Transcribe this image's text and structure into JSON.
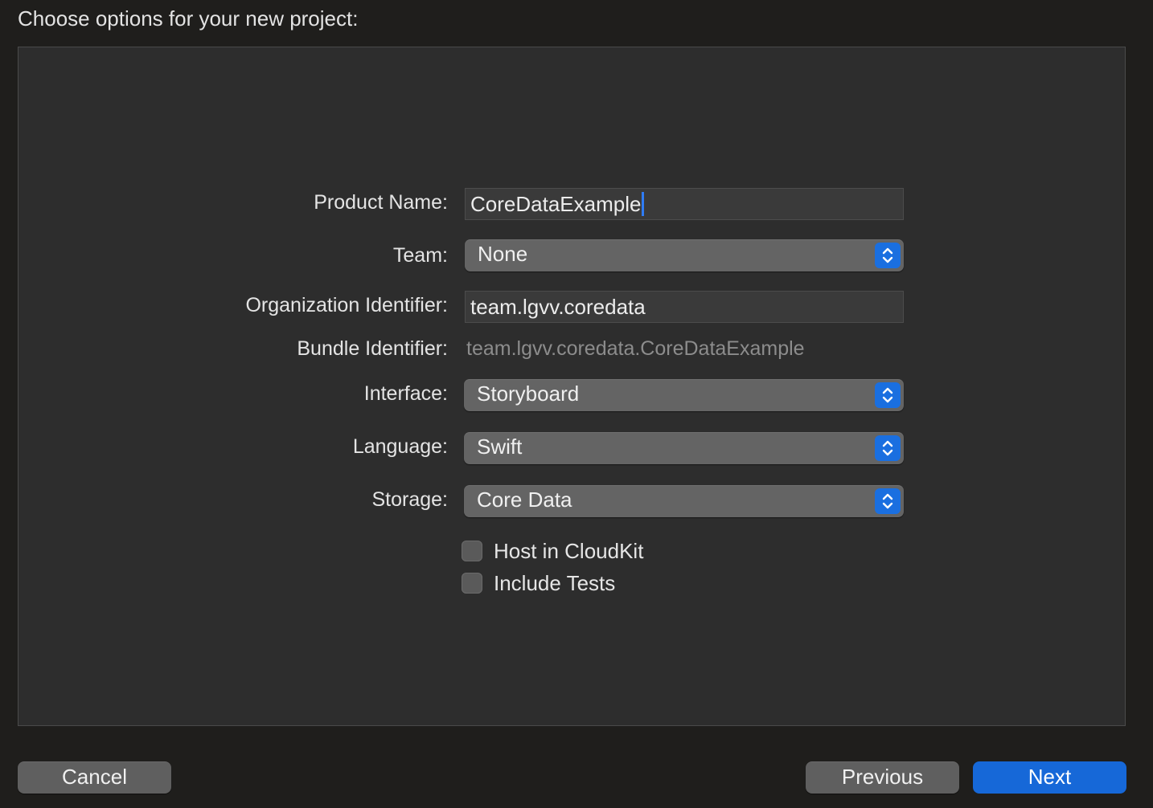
{
  "header": {
    "title": "Choose options for your new project:"
  },
  "form": {
    "product_name": {
      "label": "Product Name:",
      "value": "CoreDataExample"
    },
    "team": {
      "label": "Team:",
      "value": "None"
    },
    "organization_identifier": {
      "label": "Organization Identifier:",
      "value": "team.lgvv.coredata"
    },
    "bundle_identifier": {
      "label": "Bundle Identifier:",
      "value": "team.lgvv.coredata.CoreDataExample"
    },
    "interface": {
      "label": "Interface:",
      "value": "Storyboard"
    },
    "language": {
      "label": "Language:",
      "value": "Swift"
    },
    "storage": {
      "label": "Storage:",
      "value": "Core Data"
    },
    "checkboxes": [
      {
        "label": "Host in CloudKit",
        "checked": false
      },
      {
        "label": "Include Tests",
        "checked": false
      }
    ]
  },
  "footer": {
    "cancel_label": "Cancel",
    "previous_label": "Previous",
    "next_label": "Next"
  },
  "colors": {
    "accent": "#1668d8",
    "caret": "#2f7cf6",
    "background": "#1f1e1c",
    "panel": "#2d2d2d"
  },
  "icons": {
    "popup_stepper": "chevron-up-down-icon"
  }
}
